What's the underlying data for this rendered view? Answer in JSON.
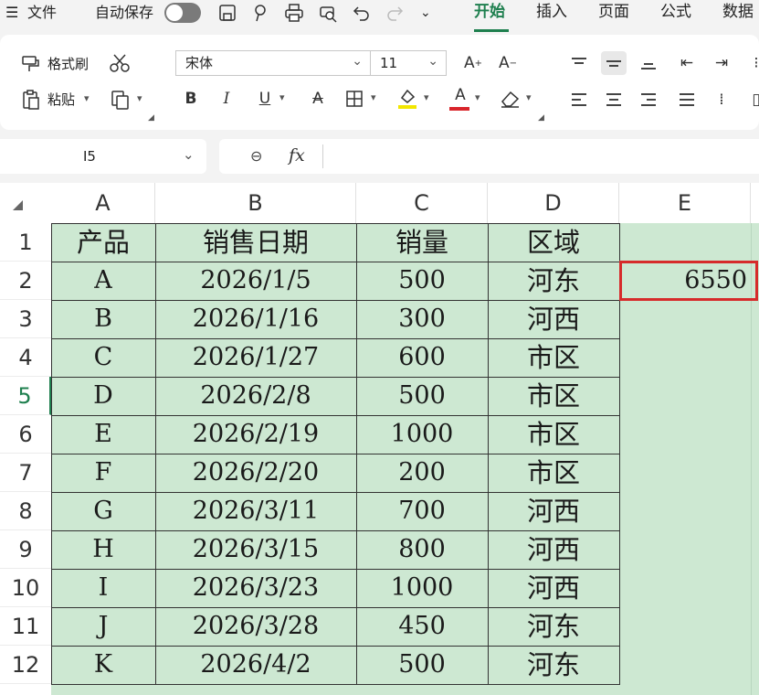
{
  "menubar": {
    "menu_icon": "hamburger-icon",
    "file_label": "文件",
    "autosave_label": "自动保存",
    "tabs": [
      {
        "label": "开始",
        "active": true
      },
      {
        "label": "插入"
      },
      {
        "label": "页面"
      },
      {
        "label": "公式"
      },
      {
        "label": "数据"
      }
    ]
  },
  "ribbon": {
    "format_painter": "格式刷",
    "paste": "粘贴",
    "font_name": "宋体",
    "font_size": "11",
    "font_color": "#d9252b",
    "fill_color": "#f2e600"
  },
  "formula_bar": {
    "name_box": "I5",
    "formula": ""
  },
  "sheet": {
    "columns": [
      "A",
      "B",
      "C",
      "D",
      "E"
    ],
    "rows": [
      "1",
      "2",
      "3",
      "4",
      "5",
      "6",
      "7",
      "8",
      "9",
      "10",
      "11",
      "12"
    ],
    "active_row": "5",
    "header": [
      "产品",
      "销售日期",
      "销量",
      "区域"
    ],
    "data": [
      [
        "A",
        "2026/1/5",
        "500",
        "河东"
      ],
      [
        "B",
        "2026/1/16",
        "300",
        "河西"
      ],
      [
        "C",
        "2026/1/27",
        "600",
        "市区"
      ],
      [
        "D",
        "2026/2/8",
        "500",
        "市区"
      ],
      [
        "E",
        "2026/2/19",
        "1000",
        "市区"
      ],
      [
        "F",
        "2026/2/20",
        "200",
        "市区"
      ],
      [
        "G",
        "2026/3/11",
        "700",
        "河西"
      ],
      [
        "H",
        "2026/3/15",
        "800",
        "河西"
      ],
      [
        "I",
        "2026/3/23",
        "1000",
        "河西"
      ],
      [
        "J",
        "2026/3/28",
        "450",
        "河东"
      ],
      [
        "K",
        "2026/4/2",
        "500",
        "河东"
      ]
    ],
    "e2_value": "6550",
    "fill_color": "#cde8d2",
    "highlight_color": "#d62b2b"
  }
}
